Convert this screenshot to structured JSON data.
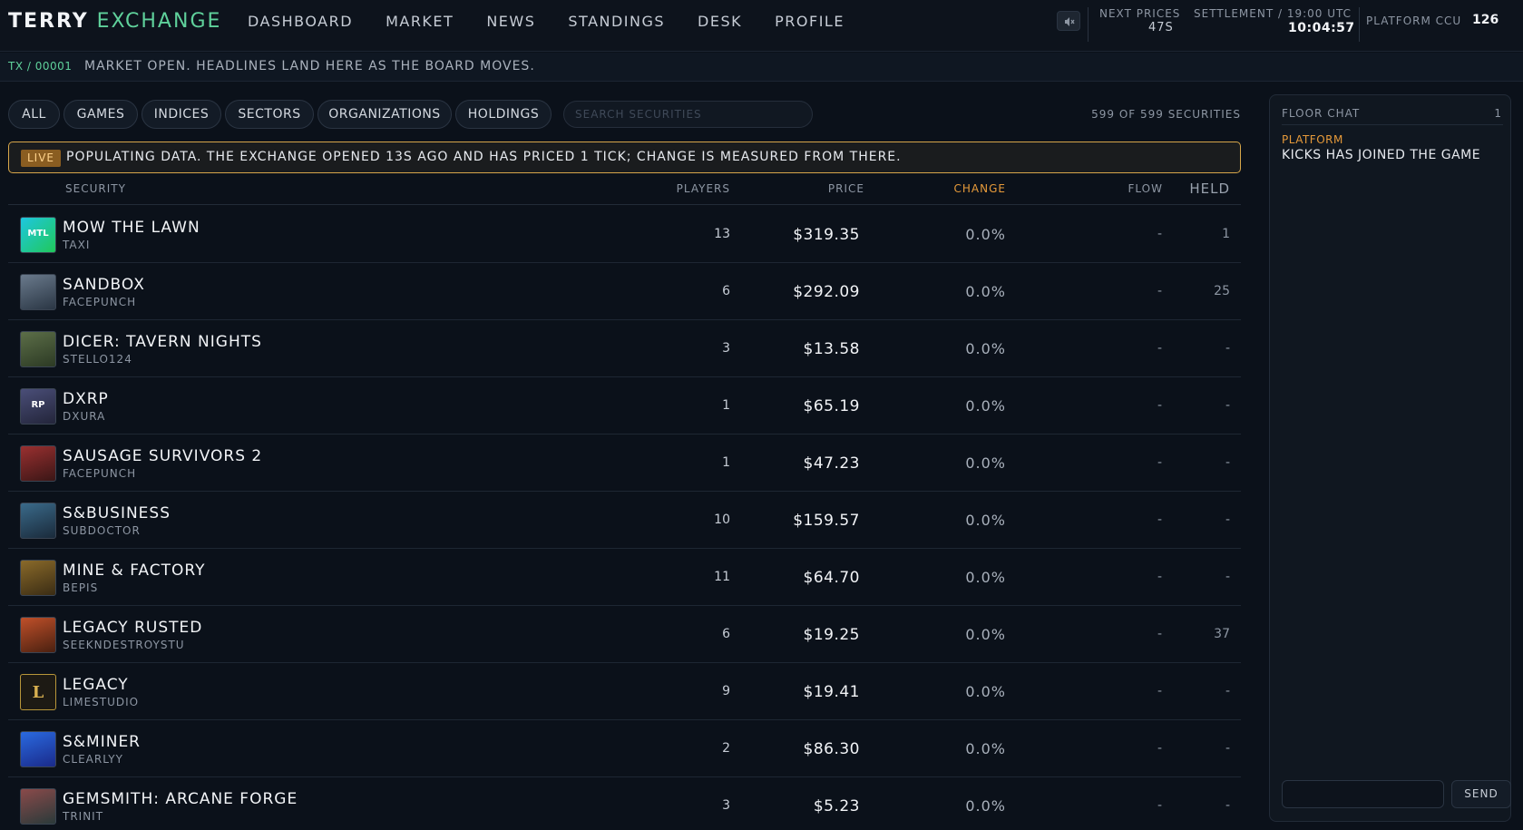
{
  "header": {
    "brand_left": "TERRY",
    "brand_right": "EXCHANGE",
    "nav": [
      "DASHBOARD",
      "MARKET",
      "NEWS",
      "STANDINGS",
      "DESK",
      "PROFILE"
    ],
    "mute_icon": "speaker-muted-icon",
    "next_prices_label": "NEXT PRICES",
    "next_prices_value": "47S",
    "settlement_label": "SETTLEMENT / 19:00 UTC",
    "settlement_value": "10:04:57",
    "ccu_label": "PLATFORM CCU",
    "ccu_value": "126"
  },
  "ticker": {
    "code": "TX / 00001",
    "message": "MARKET OPEN. HEADLINES LAND HERE AS THE BOARD MOVES."
  },
  "filters": {
    "chips": [
      "ALL",
      "GAMES",
      "INDICES",
      "SECTORS",
      "ORGANIZATIONS",
      "HOLDINGS"
    ],
    "search_placeholder": "SEARCH SECURITIES",
    "count": "599 OF 599 SECURITIES"
  },
  "banner": {
    "badge": "LIVE",
    "text": "POPULATING DATA. THE EXCHANGE OPENED 13S AGO AND HAS PRICED 1 TICK; CHANGE IS MEASURED FROM THERE."
  },
  "table": {
    "columns": {
      "security": "SECURITY",
      "players": "PLAYERS",
      "price": "PRICE",
      "change": "CHANGE",
      "flow": "FLOW",
      "held": "HELD"
    },
    "rows": [
      {
        "name": "MOW THE LAWN",
        "dev": "TAXI",
        "players": "13",
        "price": "$319.35",
        "change": "0.0%",
        "flow": "-",
        "held": "1",
        "thumb_text": "MTL",
        "thumb_color": "#18b8d6"
      },
      {
        "name": "SANDBOX",
        "dev": "FACEPUNCH",
        "players": "6",
        "price": "$292.09",
        "change": "0.0%",
        "flow": "-",
        "held": "25",
        "thumb_text": "",
        "thumb_color": "#3d4b5c"
      },
      {
        "name": "DICER: TAVERN NIGHTS",
        "dev": "STELLO124",
        "players": "3",
        "price": "$13.58",
        "change": "0.0%",
        "flow": "-",
        "held": "-",
        "thumb_text": "",
        "thumb_color": "#4a5a3c"
      },
      {
        "name": "DXRP",
        "dev": "DXURA",
        "players": "1",
        "price": "$65.19",
        "change": "0.0%",
        "flow": "-",
        "held": "-",
        "thumb_text": "RP",
        "thumb_color": "#3c3f5a"
      },
      {
        "name": "SAUSAGE SURVIVORS 2",
        "dev": "FACEPUNCH",
        "players": "1",
        "price": "$47.23",
        "change": "0.0%",
        "flow": "-",
        "held": "-",
        "thumb_text": "",
        "thumb_color": "#6a2a2a"
      },
      {
        "name": "S&BUSINESS",
        "dev": "SUBDOCTOR",
        "players": "10",
        "price": "$159.57",
        "change": "0.0%",
        "flow": "-",
        "held": "-",
        "thumb_text": "",
        "thumb_color": "#2a4a6a"
      },
      {
        "name": "MINE & FACTORY",
        "dev": "BEPIS",
        "players": "11",
        "price": "$64.70",
        "change": "0.0%",
        "flow": "-",
        "held": "-",
        "thumb_text": "",
        "thumb_color": "#6a5a2a"
      },
      {
        "name": "LEGACY RUSTED",
        "dev": "SEEKNDESTROYSTU",
        "players": "6",
        "price": "$19.25",
        "change": "0.0%",
        "flow": "-",
        "held": "37",
        "thumb_text": "",
        "thumb_color": "#8a3a1a"
      },
      {
        "name": "LEGACY",
        "dev": "LIMESTUDIO",
        "players": "9",
        "price": "$19.41",
        "change": "0.0%",
        "flow": "-",
        "held": "-",
        "thumb_text": "L",
        "thumb_color": "#1d1a14"
      },
      {
        "name": "S&MINER",
        "dev": "CLEARLYY",
        "players": "2",
        "price": "$86.30",
        "change": "0.0%",
        "flow": "-",
        "held": "-",
        "thumb_text": "",
        "thumb_color": "#1c4fc4"
      },
      {
        "name": "GEMSMITH: ARCANE FORGE",
        "dev": "TRINIT",
        "players": "3",
        "price": "$5.23",
        "change": "0.0%",
        "flow": "-",
        "held": "-",
        "thumb_text": "",
        "thumb_color": "#5a3a3a"
      }
    ]
  },
  "chat": {
    "title": "FLOOR CHAT",
    "count": "1",
    "messages": [
      {
        "author": "PLATFORM",
        "text": "KICKS HAS JOINED THE GAME"
      }
    ],
    "send_label": "SEND"
  }
}
